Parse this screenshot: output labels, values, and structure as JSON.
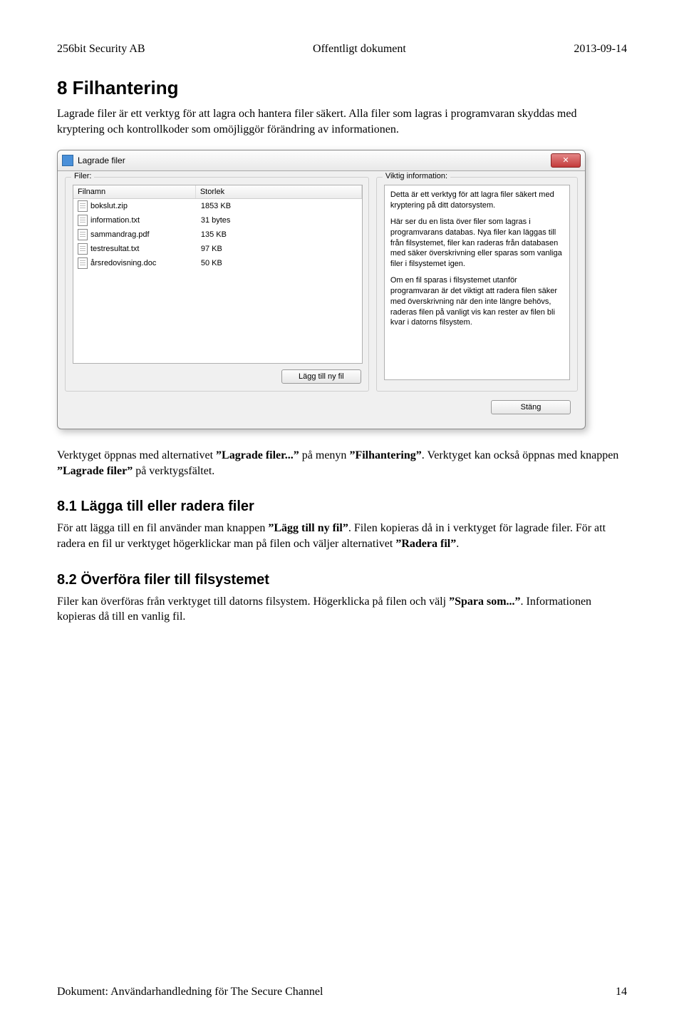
{
  "header": {
    "left": "256bit Security AB",
    "center": "Offentligt dokument",
    "right": "2013-09-14"
  },
  "h1": "8 Filhantering",
  "intro_a": "Lagrade filer är ett verktyg för att lagra och hantera filer säkert. Alla filer som lagras i programvaran skyddas med kryptering och kontrollkoder som omöjliggör förändring av informationen.",
  "dialog": {
    "title": "Lagrade filer",
    "close_x": "✕",
    "group_filer": "Filer:",
    "group_info": "Viktig information:",
    "columns": {
      "name": "Filnamn",
      "size": "Storlek"
    },
    "files": [
      {
        "name": "bokslut.zip",
        "size": "1853 KB"
      },
      {
        "name": "information.txt",
        "size": "31 bytes"
      },
      {
        "name": "sammandrag.pdf",
        "size": "135 KB"
      },
      {
        "name": "testresultat.txt",
        "size": "97 KB"
      },
      {
        "name": "årsredovisning.doc",
        "size": "50 KB"
      }
    ],
    "info_p1": "Detta är ett verktyg för att lagra filer säkert med kryptering på ditt datorsystem.",
    "info_p2": "Här ser du en lista över filer som lagras i programvarans databas. Nya filer kan läggas till från filsystemet, filer kan raderas från databasen med säker överskrivning eller sparas som vanliga filer i filsystemet igen.",
    "info_p3": "Om en fil sparas i filsystemet utanför programvaran är det viktigt att radera filen säker med överskrivning när den inte längre behövs, raderas filen på vanligt vis kan rester av filen bli kvar i datorns filsystem.",
    "btn_add": "Lägg till ny fil",
    "btn_close": "Stäng"
  },
  "mid1_a": "Verktyget öppnas med alternativet ",
  "mid1_b": "”Lagrade filer...”",
  "mid1_c": " på menyn ",
  "mid1_d": "”Filhantering”",
  "mid1_e": ". Verktyget kan också öppnas med knappen ",
  "mid1_f": "”Lagrade filer”",
  "mid1_g": " på verktygsfältet.",
  "h2a": "8.1 Lägga till eller radera filer",
  "p81_a": "För att lägga till en fil använder man knappen ",
  "p81_b": "”Lägg till ny fil”",
  "p81_c": ". Filen kopieras då in i verktyget för lagrade filer. För att radera en fil ur verktyget högerklickar man på filen och väljer alternativet ",
  "p81_d": "”Radera fil”",
  "p81_e": ".",
  "h2b": "8.2 Överföra filer till filsystemet",
  "p82_a": "Filer kan överföras från verktyget till datorns filsystem. Högerklicka på filen och välj ",
  "p82_b": "”Spara som...”",
  "p82_c": ". Informationen kopieras då till en vanlig fil.",
  "footer": {
    "left": "Dokument: Användarhandledning för The Secure Channel",
    "right": "14"
  }
}
